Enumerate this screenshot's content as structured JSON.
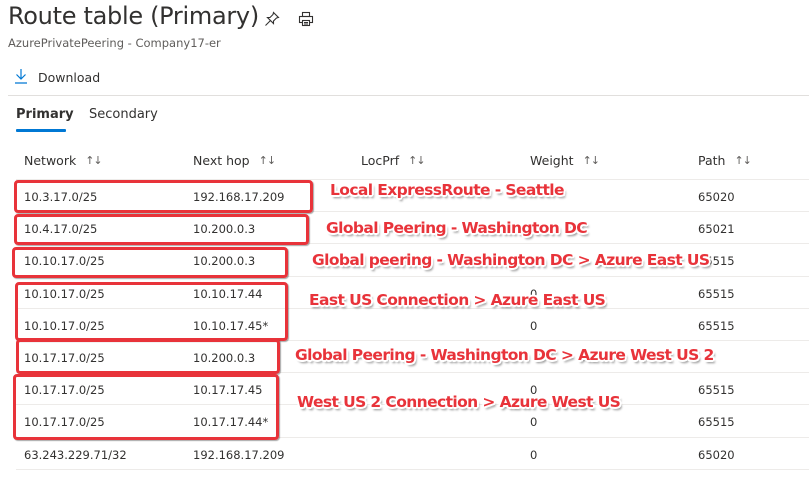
{
  "header": {
    "title": "Route table (Primary)",
    "subtitle": "AzurePrivatePeering - Company17-er",
    "pin_icon": "pin-icon",
    "print_icon": "print-icon"
  },
  "toolbar": {
    "download_label": "Download",
    "download_icon": "download-icon"
  },
  "tabs": [
    {
      "label": "Primary",
      "active": true
    },
    {
      "label": "Secondary",
      "active": false
    }
  ],
  "table": {
    "columns": [
      {
        "label": "Network",
        "sort_icon": "↑↓"
      },
      {
        "label": "Next hop",
        "sort_icon": "↑↓"
      },
      {
        "label": "LocPrf",
        "sort_icon": "↑↓"
      },
      {
        "label": "Weight",
        "sort_icon": "↑↓"
      },
      {
        "label": "Path",
        "sort_icon": "↑↓"
      }
    ],
    "rows": [
      {
        "network": "10.3.17.0/25",
        "next_hop": "192.168.17.209",
        "locprf": "",
        "weight": "",
        "path": "65020"
      },
      {
        "network": "10.4.17.0/25",
        "next_hop": "10.200.0.3",
        "locprf": "",
        "weight": "",
        "path": "65021"
      },
      {
        "network": "10.10.17.0/25",
        "next_hop": "10.200.0.3",
        "locprf": "",
        "weight": "",
        "path": "65515"
      },
      {
        "network": "10.10.17.0/25",
        "next_hop": "10.10.17.44",
        "locprf": "",
        "weight": "0",
        "path": "65515"
      },
      {
        "network": "10.10.17.0/25",
        "next_hop": "10.10.17.45*",
        "locprf": "",
        "weight": "0",
        "path": "65515"
      },
      {
        "network": "10.17.17.0/25",
        "next_hop": "10.200.0.3",
        "locprf": "",
        "weight": "",
        "path": ""
      },
      {
        "network": "10.17.17.0/25",
        "next_hop": "10.17.17.45",
        "locprf": "",
        "weight": "0",
        "path": "65515"
      },
      {
        "network": "10.17.17.0/25",
        "next_hop": "10.17.17.44*",
        "locprf": "",
        "weight": "0",
        "path": "65515"
      },
      {
        "network": "63.243.229.71/32",
        "next_hop": "192.168.17.209",
        "locprf": "",
        "weight": "0",
        "path": "65020"
      }
    ]
  },
  "annotations": {
    "color": "#e8333a",
    "labels": [
      "Local ExpressRoute - Seattle",
      "Global Peering - Washington DC",
      "Global peering - Washington DC > Azure East US",
      "East US Connection > Azure East US",
      "Global Peering - Washington DC > Azure West US 2",
      "West US 2 Connection  > Azure West US"
    ]
  }
}
